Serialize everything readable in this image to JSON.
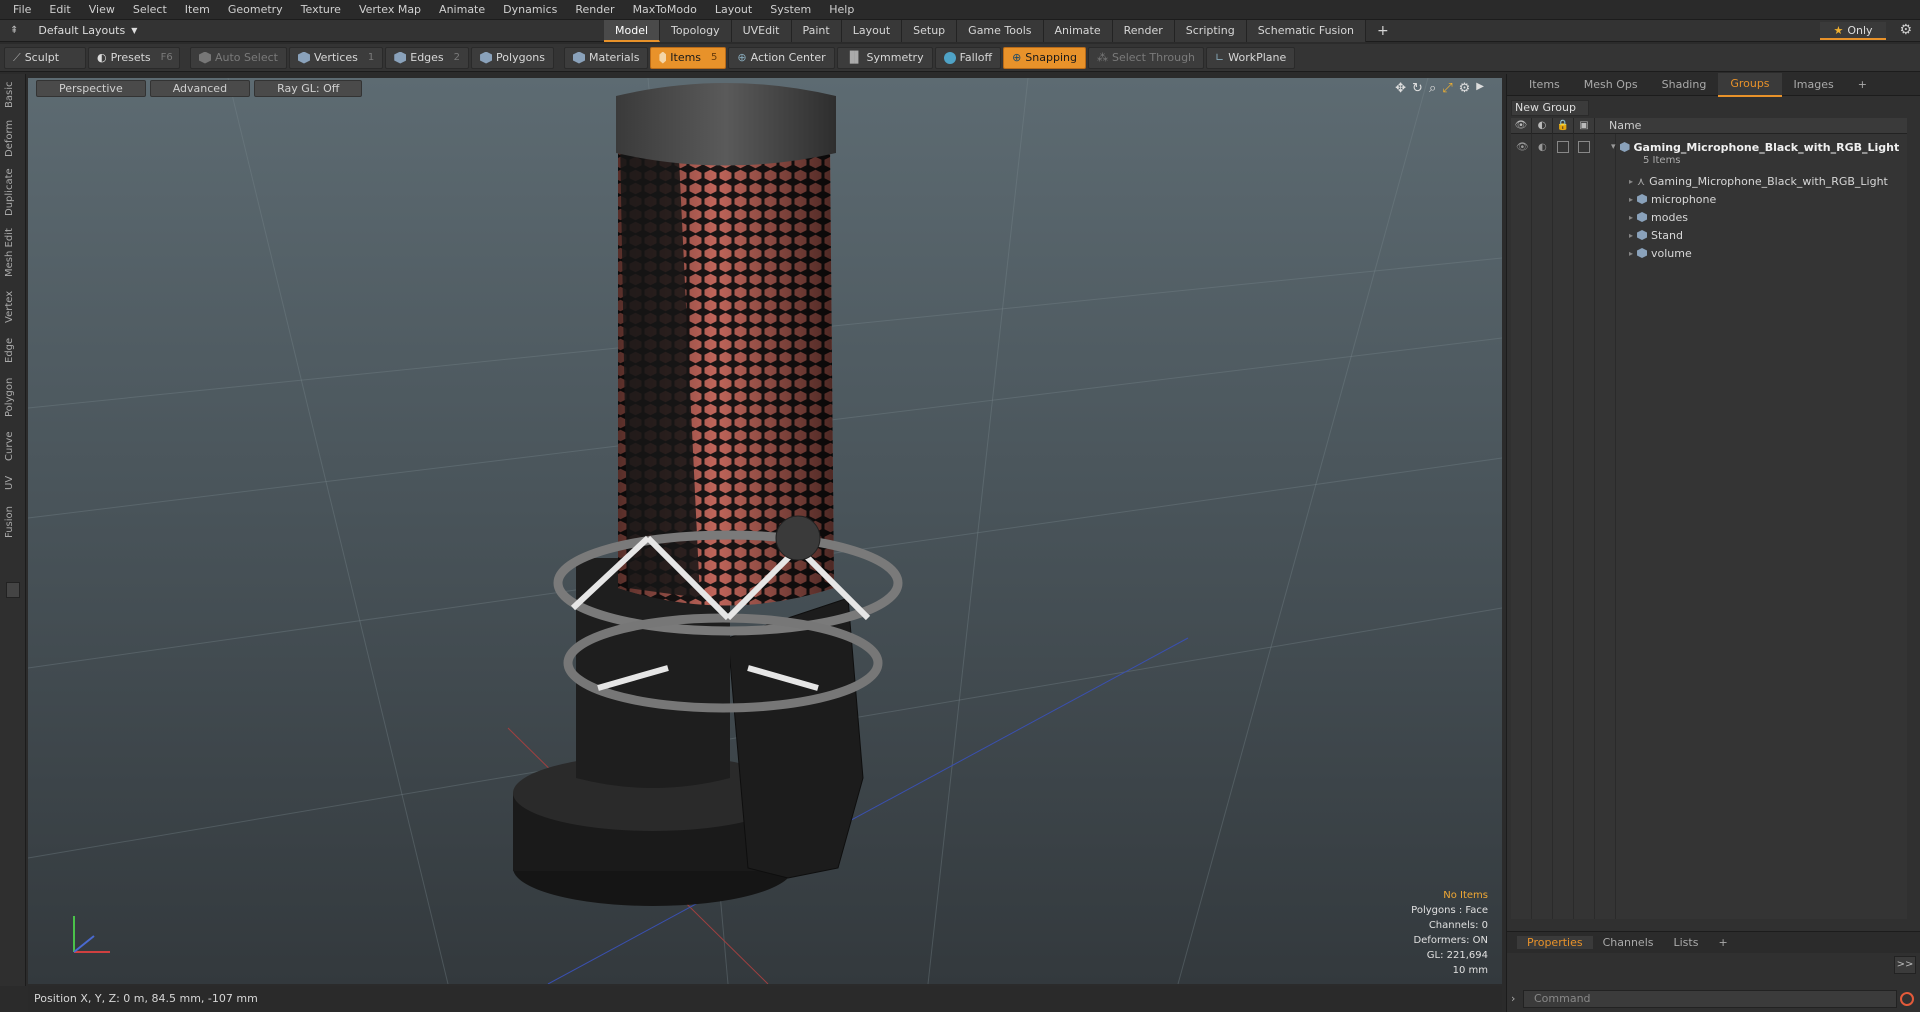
{
  "menu": [
    "File",
    "Edit",
    "View",
    "Select",
    "Item",
    "Geometry",
    "Texture",
    "Vertex Map",
    "Animate",
    "Dynamics",
    "Render",
    "MaxToModo",
    "Layout",
    "System",
    "Help"
  ],
  "layout": {
    "name": "Default Layouts"
  },
  "tabs": [
    "Model",
    "Topology",
    "UVEdit",
    "Paint",
    "Layout",
    "Setup",
    "Game Tools",
    "Animate",
    "Render",
    "Scripting",
    "Schematic Fusion"
  ],
  "tabs_plus": "+",
  "only_label": "Only",
  "toolbar": {
    "sculpt": "Sculpt",
    "presets": "Presets",
    "presets_key": "F6",
    "auto_select": "Auto Select",
    "vertices": "Vertices",
    "vertices_key": "1",
    "edges": "Edges",
    "edges_key": "2",
    "polygons": "Polygons",
    "materials": "Materials",
    "items": "Items",
    "items_key": "5",
    "action_center": "Action Center",
    "symmetry": "Symmetry",
    "falloff": "Falloff",
    "snapping": "Snapping",
    "select_through": "Select Through",
    "workplane": "WorkPlane"
  },
  "left_tabs": [
    "Basic",
    "Deform",
    "Duplicate",
    "Mesh Edit",
    "Vertex",
    "Edge",
    "Polygon",
    "Curve",
    "UV",
    "Fusion"
  ],
  "viewport": {
    "view": "Perspective",
    "shading": "Advanced",
    "raygl": "Ray GL: Off",
    "info": {
      "selection": "No Items",
      "polygons": "Polygons : Face",
      "channels": "Channels: 0",
      "deformers": "Deformers: ON",
      "gl": "GL: 221,694",
      "scale": "10 mm"
    }
  },
  "status": "Position X, Y, Z:  0 m, 84.5 mm, -107 mm",
  "right_panel": {
    "tabs": [
      "Items",
      "Mesh Ops",
      "Shading",
      "Groups",
      "Images"
    ],
    "active_tab": "Groups",
    "plus": "+",
    "new_group": "New Group",
    "column_name": "Name",
    "root": {
      "name": "Gaming_Microphone_Black_with_RGB_Light",
      "count": "5 Items"
    },
    "children": [
      "Gaming_Microphone_Black_with_RGB_Light",
      "microphone",
      "modes",
      "Stand",
      "volume"
    ]
  },
  "bottom_panel": {
    "tabs": [
      "Properties",
      "Channels",
      "Lists"
    ],
    "plus": "+",
    "expand": ">>",
    "command_placeholder": "Command"
  }
}
